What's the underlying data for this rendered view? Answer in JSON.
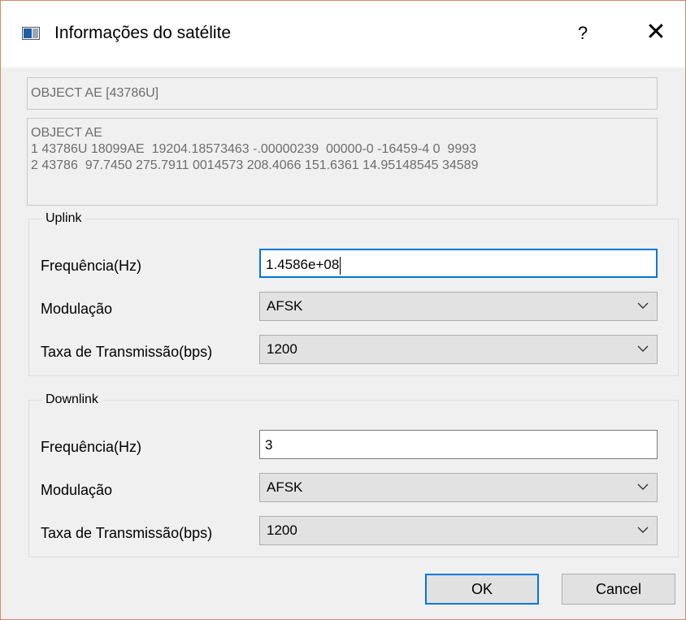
{
  "window": {
    "title": "Informações do satélite",
    "help_label": "?",
    "close_label": "✕"
  },
  "satellite": {
    "name": "OBJECT AE [43786U]",
    "tle": [
      "OBJECT AE",
      "1 43786U 18099AE  19204.18573463 -.00000239  00000-0 -16459-4 0  9993",
      "2 43786  97.7450 275.7911 0014573 208.4066 151.6361 14.95148545 34589"
    ]
  },
  "uplink": {
    "title": "Uplink",
    "frequency_label": "Frequência(Hz)",
    "frequency_value": "1.4586e+08",
    "modulation_label": "Modulação",
    "modulation_value": "AFSK",
    "rate_label": "Taxa de Transmissão(bps)",
    "rate_value": "1200"
  },
  "downlink": {
    "title": "Downlink",
    "frequency_label": "Frequência(Hz)",
    "frequency_value": "3",
    "modulation_label": "Modulação",
    "modulation_value": "AFSK",
    "rate_label": "Taxa de Transmissão(bps)",
    "rate_value": "1200"
  },
  "buttons": {
    "ok": "OK",
    "cancel": "Cancel"
  },
  "colors": {
    "accent": "#0078d7",
    "window_border": "#d08a6a"
  },
  "icons": {
    "app": "window-icon",
    "dropdown": "chevron-down-icon"
  }
}
